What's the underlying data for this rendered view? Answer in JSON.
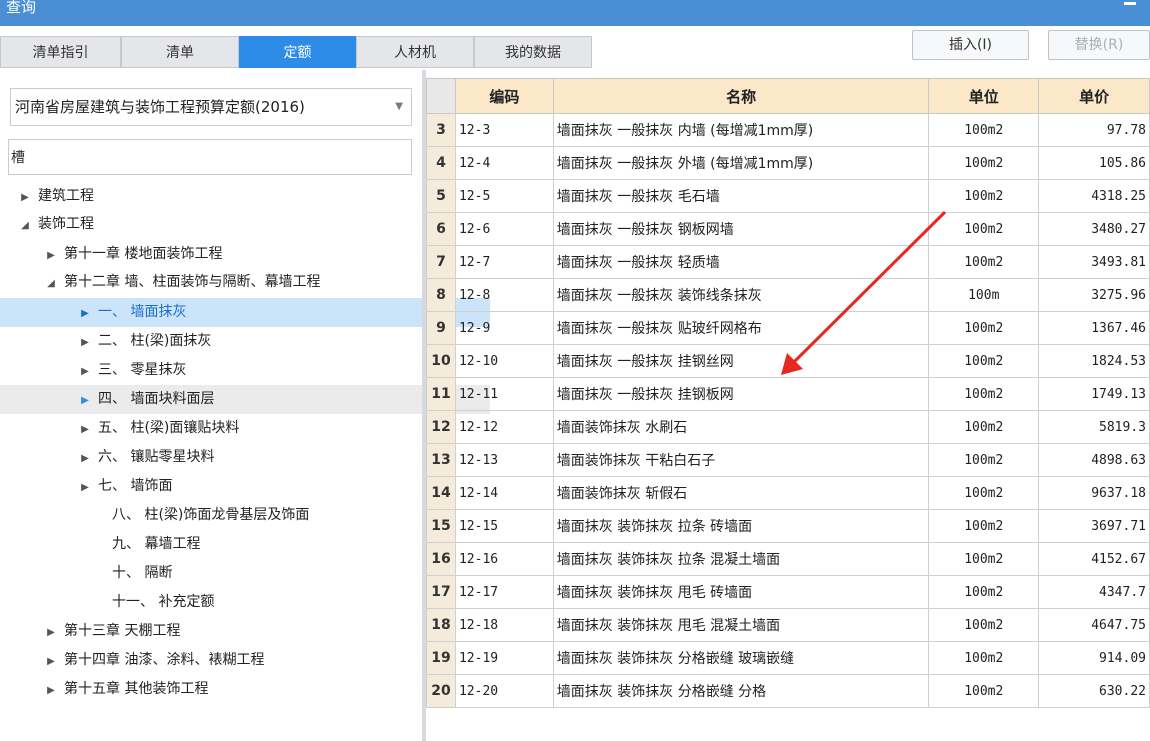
{
  "window": {
    "title": "查询"
  },
  "tabs": [
    {
      "label": "清单指引",
      "active": false
    },
    {
      "label": "清单",
      "active": false
    },
    {
      "label": "定额",
      "active": true
    },
    {
      "label": "人材机",
      "active": false
    },
    {
      "label": "我的数据",
      "active": false
    }
  ],
  "toolbar": {
    "insert_label": "插入(I)",
    "replace_label": "替换(R)"
  },
  "quota_selector": {
    "value": "河南省房屋建筑与装饰工程预算定额(2016)"
  },
  "search": {
    "value": "槽"
  },
  "tree": [
    {
      "label": "建筑工程",
      "expander": "▶"
    },
    {
      "label": "装饰工程",
      "expander": "◢"
    },
    {
      "label": "第十一章 楼地面装饰工程",
      "expander": "▶"
    },
    {
      "label": "第十二章 墙、柱面装饰与隔断、幕墙工程",
      "expander": "◢"
    },
    {
      "label": "一、 墙面抹灰",
      "expander": "▶"
    },
    {
      "label": "二、 柱(梁)面抹灰",
      "expander": "▶"
    },
    {
      "label": "三、 零星抹灰",
      "expander": "▶"
    },
    {
      "label": "四、 墙面块料面层",
      "expander": "▶"
    },
    {
      "label": "五、 柱(梁)面镶贴块料",
      "expander": "▶"
    },
    {
      "label": "六、 镶贴零星块料",
      "expander": "▶"
    },
    {
      "label": "七、 墙饰面",
      "expander": "▶"
    },
    {
      "label": "八、 柱(梁)饰面龙骨基层及饰面",
      "expander": ""
    },
    {
      "label": "九、 幕墙工程",
      "expander": ""
    },
    {
      "label": "十、 隔断",
      "expander": ""
    },
    {
      "label": "十一、 补充定额",
      "expander": ""
    },
    {
      "label": "第十三章 天棚工程",
      "expander": "▶"
    },
    {
      "label": "第十四章 油漆、涂料、裱糊工程",
      "expander": "▶"
    },
    {
      "label": "第十五章 其他装饰工程",
      "expander": "▶"
    }
  ],
  "table": {
    "headers": {
      "code": "编码",
      "name": "名称",
      "unit": "单位",
      "price": "单价"
    },
    "rows": [
      {
        "n": "3",
        "code": "12-3",
        "name": "墙面抹灰 一般抹灰 内墙 (每增减1mm厚)",
        "unit": "100m2",
        "price": "97.78"
      },
      {
        "n": "4",
        "code": "12-4",
        "name": "墙面抹灰 一般抹灰 外墙 (每增减1mm厚)",
        "unit": "100m2",
        "price": "105.86"
      },
      {
        "n": "5",
        "code": "12-5",
        "name": "墙面抹灰 一般抹灰 毛石墙",
        "unit": "100m2",
        "price": "4318.25"
      },
      {
        "n": "6",
        "code": "12-6",
        "name": "墙面抹灰 一般抹灰 钢板网墙",
        "unit": "100m2",
        "price": "3480.27"
      },
      {
        "n": "7",
        "code": "12-7",
        "name": "墙面抹灰 一般抹灰 轻质墙",
        "unit": "100m2",
        "price": "3493.81"
      },
      {
        "n": "8",
        "code": "12-8",
        "name": "墙面抹灰 一般抹灰 装饰线条抹灰",
        "unit": "100m",
        "price": "3275.96"
      },
      {
        "n": "9",
        "code": "12-9",
        "name": "墙面抹灰 一般抹灰 贴玻纤网格布",
        "unit": "100m2",
        "price": "1367.46"
      },
      {
        "n": "10",
        "code": "12-10",
        "name": "墙面抹灰 一般抹灰 挂钢丝网",
        "unit": "100m2",
        "price": "1824.53"
      },
      {
        "n": "11",
        "code": "12-11",
        "name": "墙面抹灰 一般抹灰 挂钢板网",
        "unit": "100m2",
        "price": "1749.13"
      },
      {
        "n": "12",
        "code": "12-12",
        "name": "墙面装饰抹灰 水刷石",
        "unit": "100m2",
        "price": "5819.3"
      },
      {
        "n": "13",
        "code": "12-13",
        "name": "墙面装饰抹灰 干粘白石子",
        "unit": "100m2",
        "price": "4898.63"
      },
      {
        "n": "14",
        "code": "12-14",
        "name": "墙面装饰抹灰 斩假石",
        "unit": "100m2",
        "price": "9637.18"
      },
      {
        "n": "15",
        "code": "12-15",
        "name": "墙面抹灰 装饰抹灰 拉条 砖墙面",
        "unit": "100m2",
        "price": "3697.71"
      },
      {
        "n": "16",
        "code": "12-16",
        "name": "墙面抹灰 装饰抹灰 拉条 混凝土墙面",
        "unit": "100m2",
        "price": "4152.67"
      },
      {
        "n": "17",
        "code": "12-17",
        "name": "墙面抹灰 装饰抹灰 甩毛 砖墙面",
        "unit": "100m2",
        "price": "4347.7"
      },
      {
        "n": "18",
        "code": "12-18",
        "name": "墙面抹灰 装饰抹灰 甩毛 混凝土墙面",
        "unit": "100m2",
        "price": "4647.75"
      },
      {
        "n": "19",
        "code": "12-19",
        "name": "墙面抹灰 装饰抹灰 分格嵌缝 玻璃嵌缝",
        "unit": "100m2",
        "price": "914.09"
      },
      {
        "n": "20",
        "code": "12-20",
        "name": "墙面抹灰 装饰抹灰 分格嵌缝 分格",
        "unit": "100m2",
        "price": "630.22"
      }
    ]
  },
  "colors": {
    "accent": "#2c8ce8",
    "titlebar": "#4a8fd6",
    "header": "#fbe8c8",
    "annotation": "#e8281e"
  }
}
